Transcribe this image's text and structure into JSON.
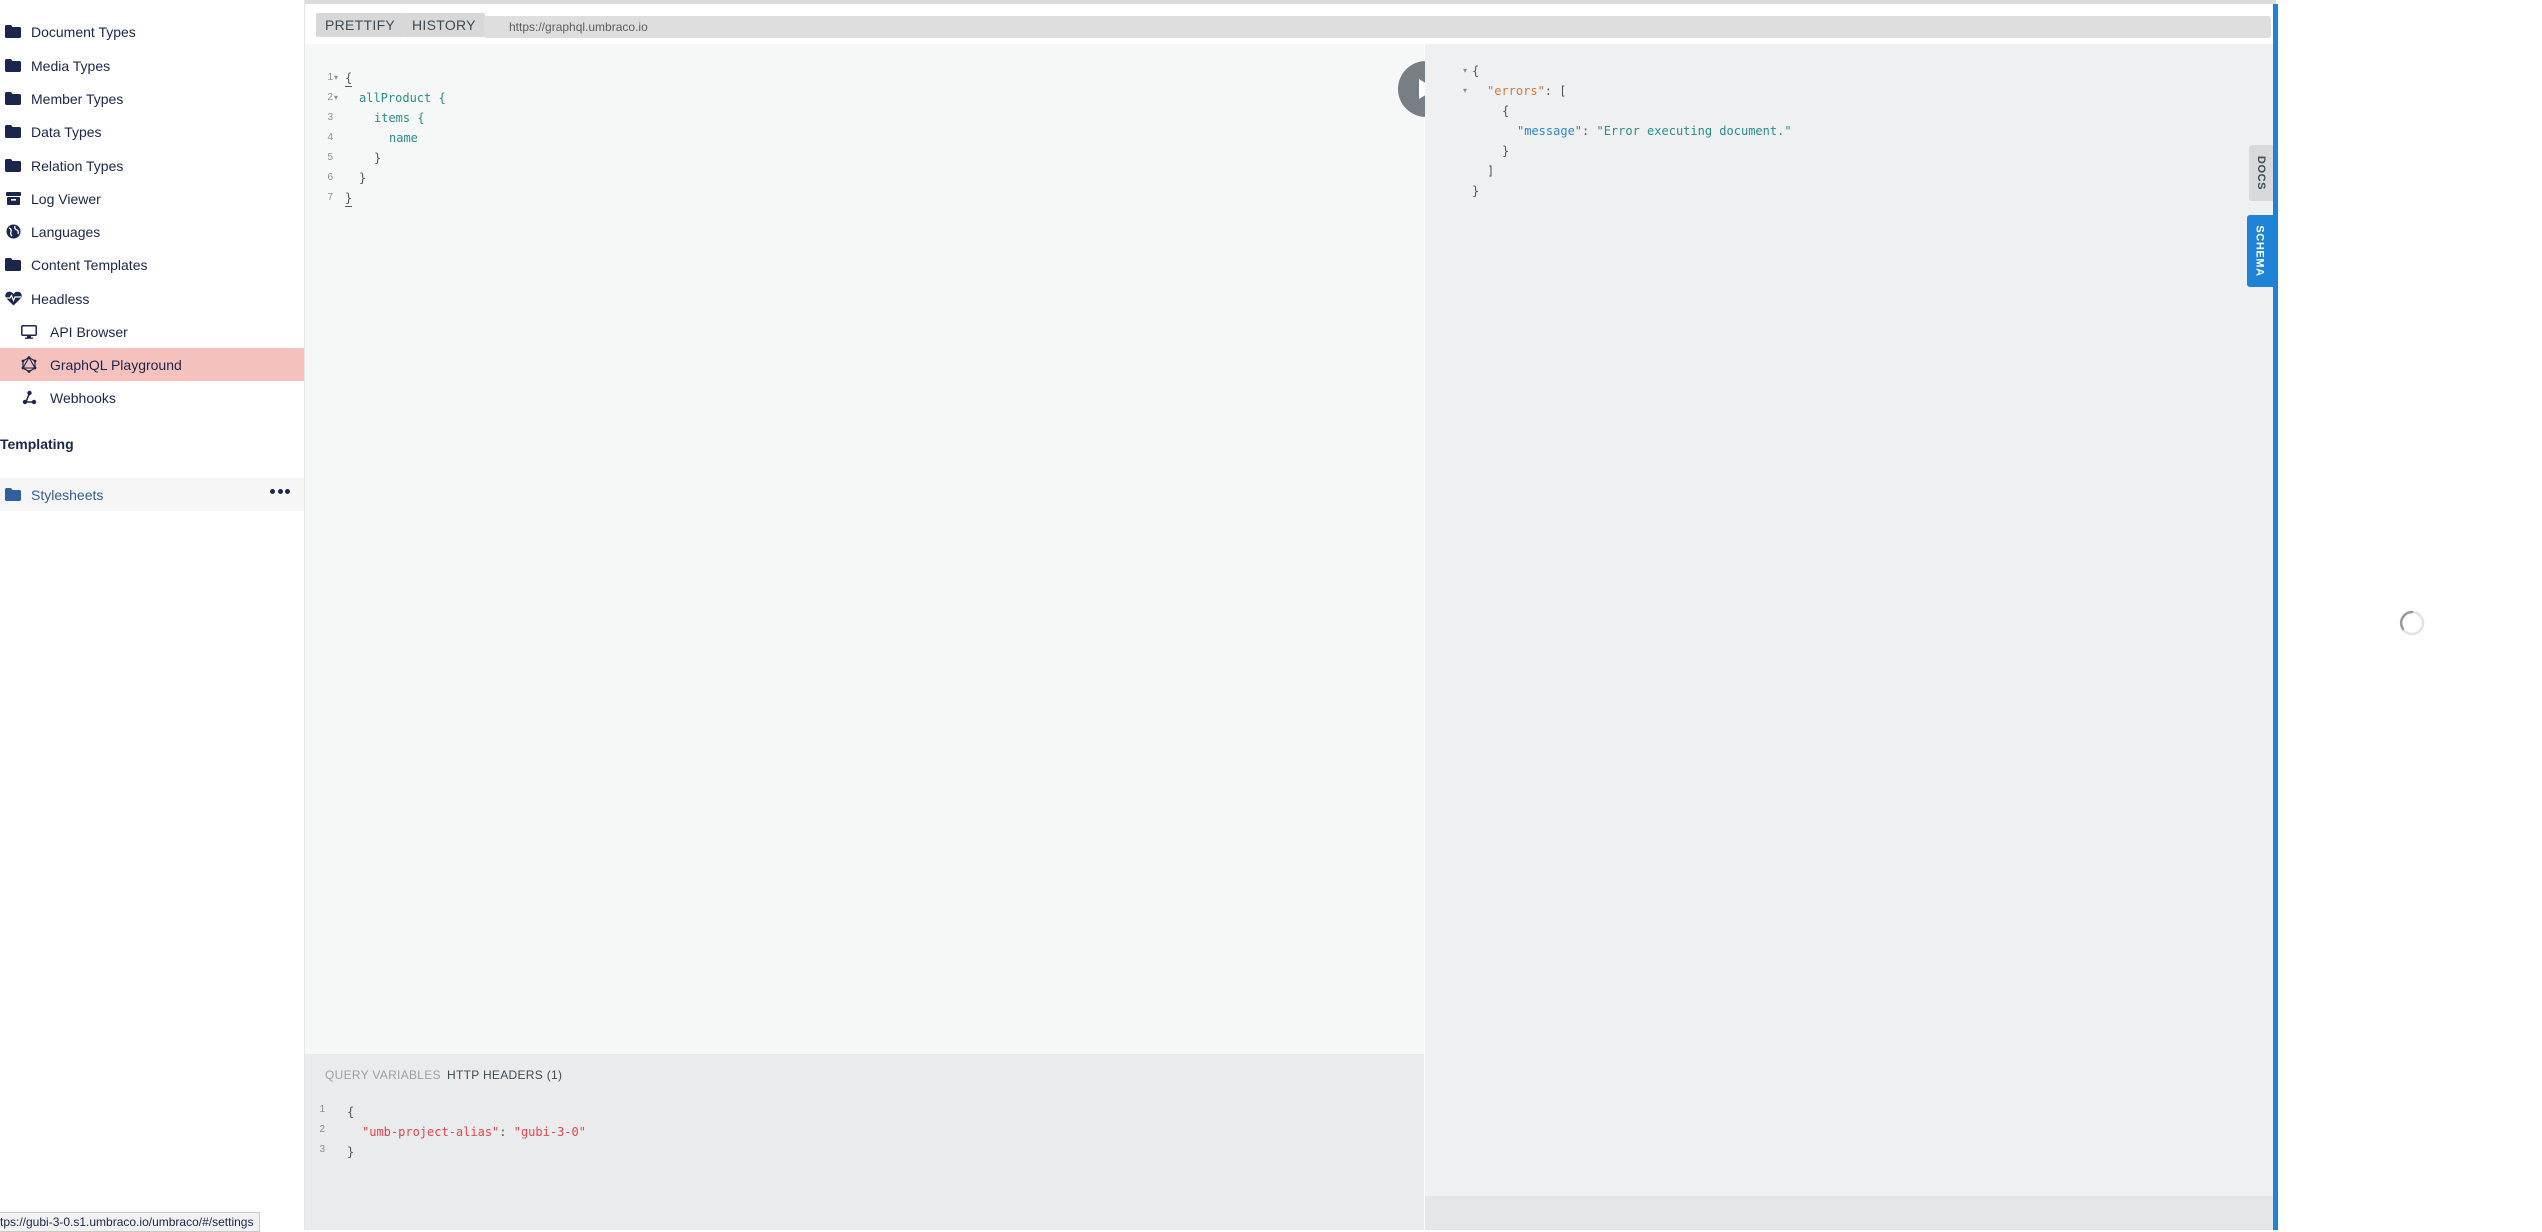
{
  "sidebar": {
    "items": [
      {
        "label": "Document Types",
        "icon": "folder-icon"
      },
      {
        "label": "Media Types",
        "icon": "folder-icon"
      },
      {
        "label": "Member Types",
        "icon": "folder-icon"
      },
      {
        "label": "Data Types",
        "icon": "folder-icon"
      },
      {
        "label": "Relation Types",
        "icon": "folder-icon"
      },
      {
        "label": "Log Viewer",
        "icon": "archive-box-icon"
      },
      {
        "label": "Languages",
        "icon": "globe-icon"
      },
      {
        "label": "Content Templates",
        "icon": "folder-icon"
      },
      {
        "label": "Headless",
        "icon": "heart-pulse-icon"
      },
      {
        "label": "API Browser",
        "icon": "monitor-icon"
      },
      {
        "label": "GraphQL Playground",
        "icon": "graphql-icon"
      },
      {
        "label": "Webhooks",
        "icon": "webhook-icon"
      }
    ],
    "section_templating": "Templating",
    "stylesheets": "Stylesheets",
    "status_url": "tps://gubi-3-0.s1.umbraco.io/umbraco/#/settings"
  },
  "toolbar": {
    "prettify": "PRETTIFY",
    "history": "HISTORY",
    "endpoint_url": "https://graphql.umbraco.io"
  },
  "editor": {
    "line_numbers": [
      "1",
      "2",
      "3",
      "4",
      "5",
      "6",
      "7"
    ],
    "lines": {
      "l1": "{",
      "l2": "allProduct {",
      "l3": "items {",
      "l4": "name",
      "l5": "}",
      "l6": "}",
      "l7": "}"
    }
  },
  "result": {
    "open_brace": "{",
    "errors_key": "\"errors\"",
    "colon_bracket": ": [",
    "inner_open": "{",
    "message_key": "\"message\"",
    "colon": ": ",
    "message_value": "\"Error executing document.\"",
    "inner_close": "}",
    "close_bracket": "]",
    "close_brace": "}"
  },
  "bottom_panel": {
    "tab_query_variables": "QUERY VARIABLES",
    "tab_http_headers": "HTTP HEADERS (1)",
    "line_numbers": [
      "1",
      "2",
      "3"
    ],
    "open_brace": "{",
    "header_key": "\"umb-project-alias\"",
    "colon": ": ",
    "header_value": "\"gubi-3-0\"",
    "close_brace": "}"
  },
  "side_tabs": {
    "docs": "DOCS",
    "schema": "SCHEMA"
  },
  "colors": {
    "accent_blue": "#1e82d6",
    "active_nav": "#f5c1bc",
    "nav_text": "#1b264f",
    "json_key_orange": "#d07a3b",
    "json_key_blue": "#2f86d2",
    "json_string_teal": "#2a8e8c",
    "header_string_red": "#e8444f"
  }
}
